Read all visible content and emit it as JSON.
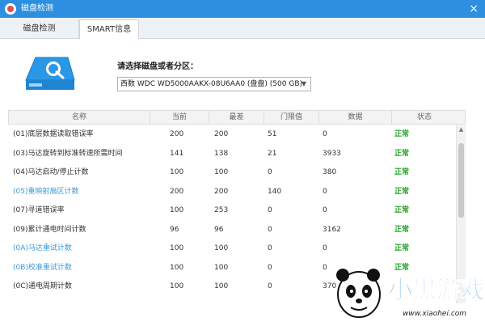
{
  "window": {
    "title": "磁盘检测",
    "close_icon": "×"
  },
  "tabs": [
    {
      "label": "磁盘检测"
    },
    {
      "label": "SMART信息"
    }
  ],
  "disk": {
    "select_label": "请选择磁盘或者分区：",
    "selected": "西数 WDC WD5000AAKX-08U6AA0 (盘盘) (500 GB)"
  },
  "table": {
    "columns": [
      "名称",
      "当前",
      "最差",
      "门限值",
      "数据",
      "状态"
    ],
    "rows": [
      {
        "name": "(01)底层数据读取错误率",
        "current": "200",
        "worst": "200",
        "threshold": "51",
        "data": "0",
        "status": "正常",
        "highlight": false
      },
      {
        "name": "(03)马达旋转到标准转速所需时间",
        "current": "141",
        "worst": "138",
        "threshold": "21",
        "data": "3933",
        "status": "正常",
        "highlight": false
      },
      {
        "name": "(04)马达启动/停止计数",
        "current": "100",
        "worst": "100",
        "threshold": "0",
        "data": "380",
        "status": "正常",
        "highlight": false
      },
      {
        "name": "(05)重映射扇区计数",
        "current": "200",
        "worst": "200",
        "threshold": "140",
        "data": "0",
        "status": "正常",
        "highlight": true
      },
      {
        "name": "(07)寻道错误率",
        "current": "100",
        "worst": "253",
        "threshold": "0",
        "data": "0",
        "status": "正常",
        "highlight": false
      },
      {
        "name": "(09)累计通电时间计数",
        "current": "96",
        "worst": "96",
        "threshold": "0",
        "data": "3162",
        "status": "正常",
        "highlight": false
      },
      {
        "name": "(0A)马达重试计数",
        "current": "100",
        "worst": "100",
        "threshold": "0",
        "data": "0",
        "status": "正常",
        "highlight": true
      },
      {
        "name": "(0B)校准重试计数",
        "current": "100",
        "worst": "100",
        "threshold": "0",
        "data": "0",
        "status": "正常",
        "highlight": true
      },
      {
        "name": "(0C)通电周期计数",
        "current": "100",
        "worst": "100",
        "threshold": "0",
        "data": "370",
        "status": "",
        "highlight": false
      }
    ]
  },
  "colors": {
    "titlebar": "#2d8fdf",
    "status_ok": "#27a327",
    "highlight_name": "#3a9ad9"
  },
  "watermark": {
    "text": "小黑游戏",
    "url": "www.xiaohei.com"
  }
}
